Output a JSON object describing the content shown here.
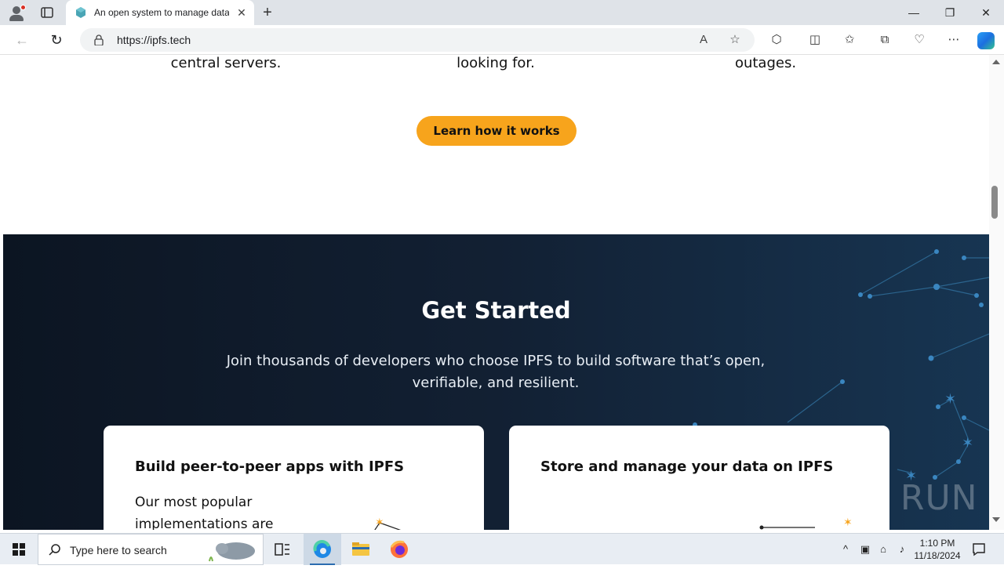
{
  "browser": {
    "tab_title": "An open system to manage data without a central server",
    "url": "https://ipfs.tech",
    "new_tab_symbol": "+",
    "icons": [
      "profile-icon",
      "tab-actions-icon",
      "back-icon",
      "refresh-icon",
      "lock-icon",
      "read-aloud-icon",
      "favorite-star-icon",
      "extensions-icon",
      "split-screen-icon",
      "favorites-icon",
      "collections-icon",
      "browser-essentials-icon",
      "more-icon",
      "copilot-icon"
    ]
  },
  "page": {
    "feature_fragments": [
      "central servers.",
      "looking for.",
      "outages."
    ],
    "cta_label": "Learn how it works",
    "get_started": {
      "title": "Get Started",
      "subtitle": "Join thousands of developers who choose IPFS to build software that’s open, verifiable, and resilient.",
      "cards": [
        {
          "title": "Build peer-to-peer apps with IPFS",
          "body": "Our most popular implementations are"
        },
        {
          "title": "Store and manage your data on IPFS",
          "body": ""
        }
      ]
    },
    "accent_color": "#f7a41c",
    "section_colors": [
      "#0c1522",
      "#173552"
    ]
  },
  "watermark": "ANY RUN",
  "taskbar": {
    "search_placeholder": "Type here to search",
    "time": "1:10 PM",
    "date": "11/18/2024",
    "apps": [
      "task-view-icon",
      "edge-icon",
      "file-explorer-icon",
      "firefox-icon"
    ]
  }
}
